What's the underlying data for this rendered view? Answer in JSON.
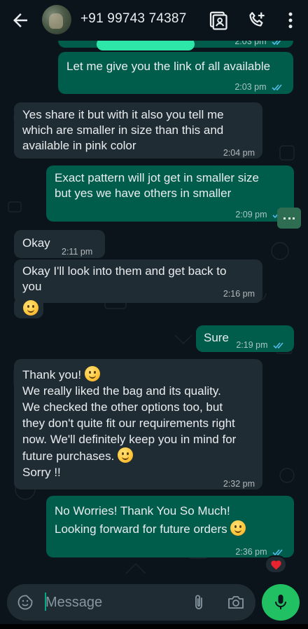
{
  "header": {
    "contact": "+91 99743 74387",
    "icons": [
      "back-arrow-icon",
      "contact-card-icon",
      "add-call-icon",
      "more-vert-icon"
    ]
  },
  "messages": [
    {
      "dir": "out",
      "text": "",
      "time": "2:03 pm",
      "status": "read"
    },
    {
      "dir": "out",
      "text": "Let me give you the link of all available",
      "time": "2:03 pm",
      "status": "read"
    },
    {
      "dir": "in",
      "lines": [
        "Yes share it but with it also you tell me",
        "which are smaller in size than this and",
        "available in pink color"
      ],
      "time": "2:04 pm"
    },
    {
      "dir": "out",
      "lines": [
        "Exact pattern will jot get in smaller size",
        "but yes we have others in smaller"
      ],
      "time": "2:09 pm",
      "status": "read"
    },
    {
      "dir": "in",
      "text": "Okay",
      "time": "2:11 pm"
    },
    {
      "dir": "in",
      "lines": [
        "Okay I'll look into them and get back to",
        "you"
      ],
      "time": "2:16 pm"
    },
    {
      "dir": "in",
      "emoji": "smiling-face-emoji"
    },
    {
      "dir": "out",
      "text": "Sure",
      "time": "2:19 pm",
      "status": "read"
    },
    {
      "dir": "in",
      "lines": [
        "Thank you!",
        "We really liked the bag and its quality.",
        "We checked the other options too, but",
        "they don't quite fit our requirements right",
        "now. We'll definitely keep you in mind for",
        "future purchases.",
        "Sorry !!"
      ],
      "time": "2:32 pm"
    },
    {
      "dir": "out",
      "lines": [
        "No Worries! Thank You So Much!",
        "Looking forward for future orders"
      ],
      "time": "2:36 pm",
      "status": "read",
      "reaction": "red-heart"
    }
  ],
  "input": {
    "placeholder": "Message"
  },
  "colors": {
    "incoming": "#202c33",
    "outgoing": "#005c4b",
    "read_ticks": "#53bdeb",
    "mic": "#21c063",
    "bg": "#0b141a",
    "redaction": "#2ee6a8"
  }
}
